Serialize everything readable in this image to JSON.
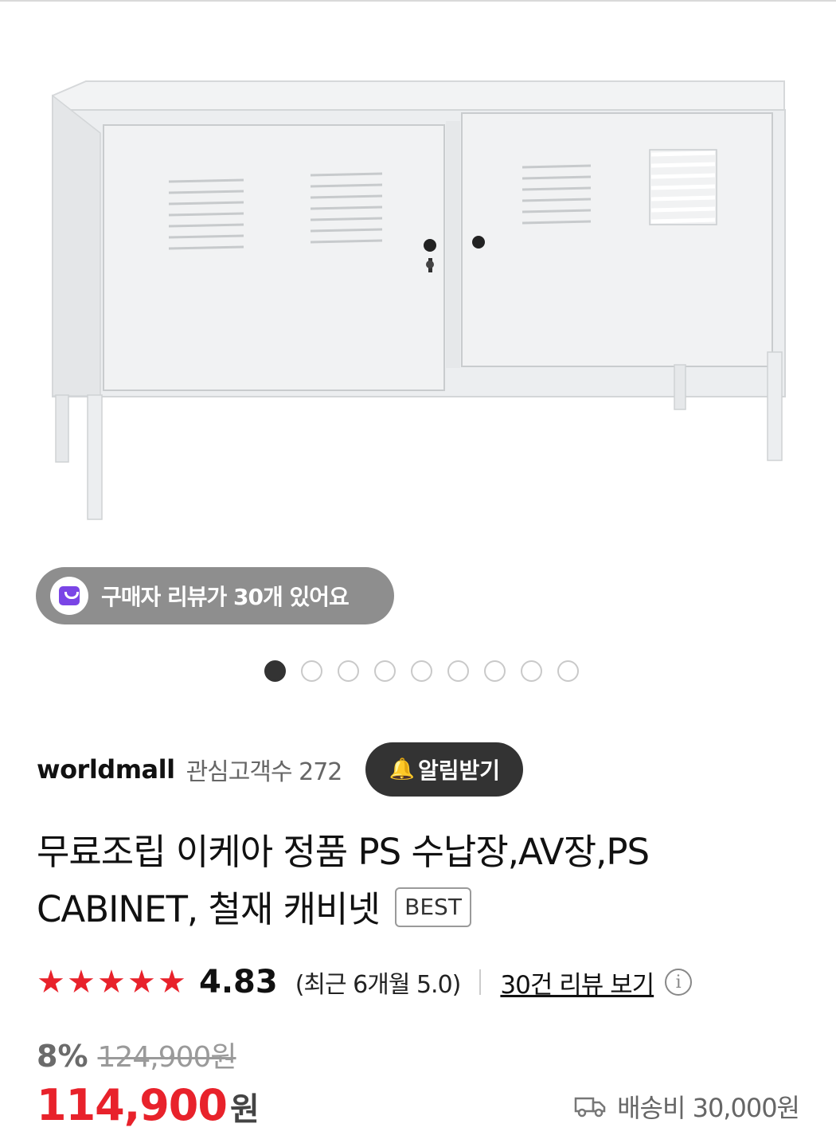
{
  "gallery": {
    "review_badge": "구매자 리뷰가 30개 있어요",
    "total_images": 9,
    "active_index": 0
  },
  "seller": {
    "name": "worldmall",
    "followers": "관심고객수 272",
    "alert_button": "알림받기"
  },
  "product": {
    "title": "무료조립 이케아 정품 PS 수납장,AV장,PS CABINET, 철재 캐비넷",
    "badge": "BEST"
  },
  "rating": {
    "stars": 5,
    "score": "4.83",
    "recent": "(최근 6개월 5.0)",
    "review_link": "30건 리뷰 보기"
  },
  "price": {
    "discount": "8%",
    "original": "124,900원",
    "sale": "114,900",
    "unit": "원"
  },
  "shipping": {
    "text": "배송비 30,000원"
  },
  "colors": {
    "accent_red": "#e8222b",
    "pill_bg": "#8e8e8e",
    "bag_purple": "#7a45e6",
    "button_dark": "#333333"
  },
  "icons": [
    "bag-icon",
    "bell-plus-icon",
    "star-icon",
    "info-icon",
    "truck-icon"
  ]
}
